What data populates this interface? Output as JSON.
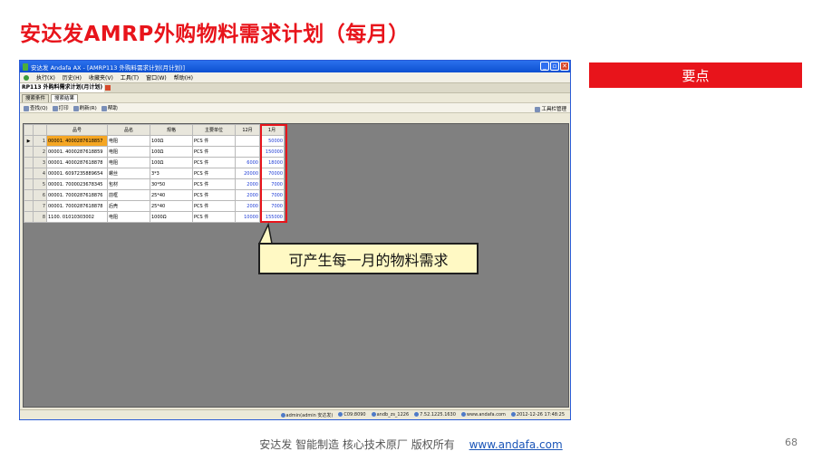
{
  "slide": {
    "title": "安达发AMRP外购物料需求计划（每月）",
    "keypoint_label": "要点",
    "callout_text": "可产生每一月的物料需求",
    "footer_text": "安达发   智能制造 核心技术原厂    版权所有",
    "footer_link": "www.andafa.com",
    "page_number": "68"
  },
  "colors": {
    "accent_red": "#e8141b",
    "callout_fill": "#fff9c4",
    "title_blue": "#0c4fd1"
  },
  "app": {
    "window_title": "安达发 Andafa AX - [AMRP113 外购料需求计划(月计划)]",
    "window_buttons": [
      "_",
      "▫",
      "✕"
    ],
    "menu": [
      "执行(X)",
      "历史(H)",
      "收藏夹(V)",
      "工具(T)",
      "窗口(W)",
      "帮助(H)"
    ],
    "document_tab": "RP113 外购料需求计划(月计划)",
    "tabs": [
      "搜索条件",
      "搜索结果"
    ],
    "toolbar": {
      "query": "查找(Q)",
      "print": "打印",
      "refresh": "刷新(R)",
      "help": "帮助",
      "toolbar_manage": "工具栏管理"
    },
    "grid": {
      "columns": [
        "品号",
        "品名",
        "规格",
        "主要单位",
        "12月",
        "1月"
      ],
      "rows": [
        {
          "no": "1",
          "code": "00001. 4000287618857",
          "name": "电阻",
          "spec": "100Ω",
          "unit": "PCS 件",
          "dec": "",
          "jan": "50000"
        },
        {
          "no": "2",
          "code": "00001. 4000287618859",
          "name": "电阻",
          "spec": "100Ω",
          "unit": "PCS 件",
          "dec": "",
          "jan": "150000"
        },
        {
          "no": "3",
          "code": "00001. 4000287618878",
          "name": "电阻",
          "spec": "100Ω",
          "unit": "PCS 件",
          "dec": "6000",
          "jan": "18000"
        },
        {
          "no": "4",
          "code": "00001. 6097235889654",
          "name": "螺丝",
          "spec": "3*3",
          "unit": "PCS 件",
          "dec": "20000",
          "jan": "70000"
        },
        {
          "no": "5",
          "code": "00001. 7000023678345",
          "name": "包材",
          "spec": "30*50",
          "unit": "PCS 件",
          "dec": "2000",
          "jan": "7000"
        },
        {
          "no": "6",
          "code": "00001. 7000287618876",
          "name": "前框",
          "spec": "25*40",
          "unit": "PCS 件",
          "dec": "2000",
          "jan": "7000"
        },
        {
          "no": "7",
          "code": "00001. 7000287618878",
          "name": "后壳",
          "spec": "25*40",
          "unit": "PCS 件",
          "dec": "2000",
          "jan": "7000"
        },
        {
          "no": "8",
          "code": "1100. 01010303002",
          "name": "电阻",
          "spec": "1000Ω",
          "unit": "PCS 件",
          "dec": "10000",
          "jan": "155000"
        }
      ]
    },
    "statusbar": {
      "user": "admin(admin 安达发)",
      "company": "C09:8090",
      "db": "andb_zs_1226",
      "version": "7.52.1225.1630",
      "site": "www.andafa.com",
      "datetime": "2012-12-26 17:48:25"
    }
  }
}
